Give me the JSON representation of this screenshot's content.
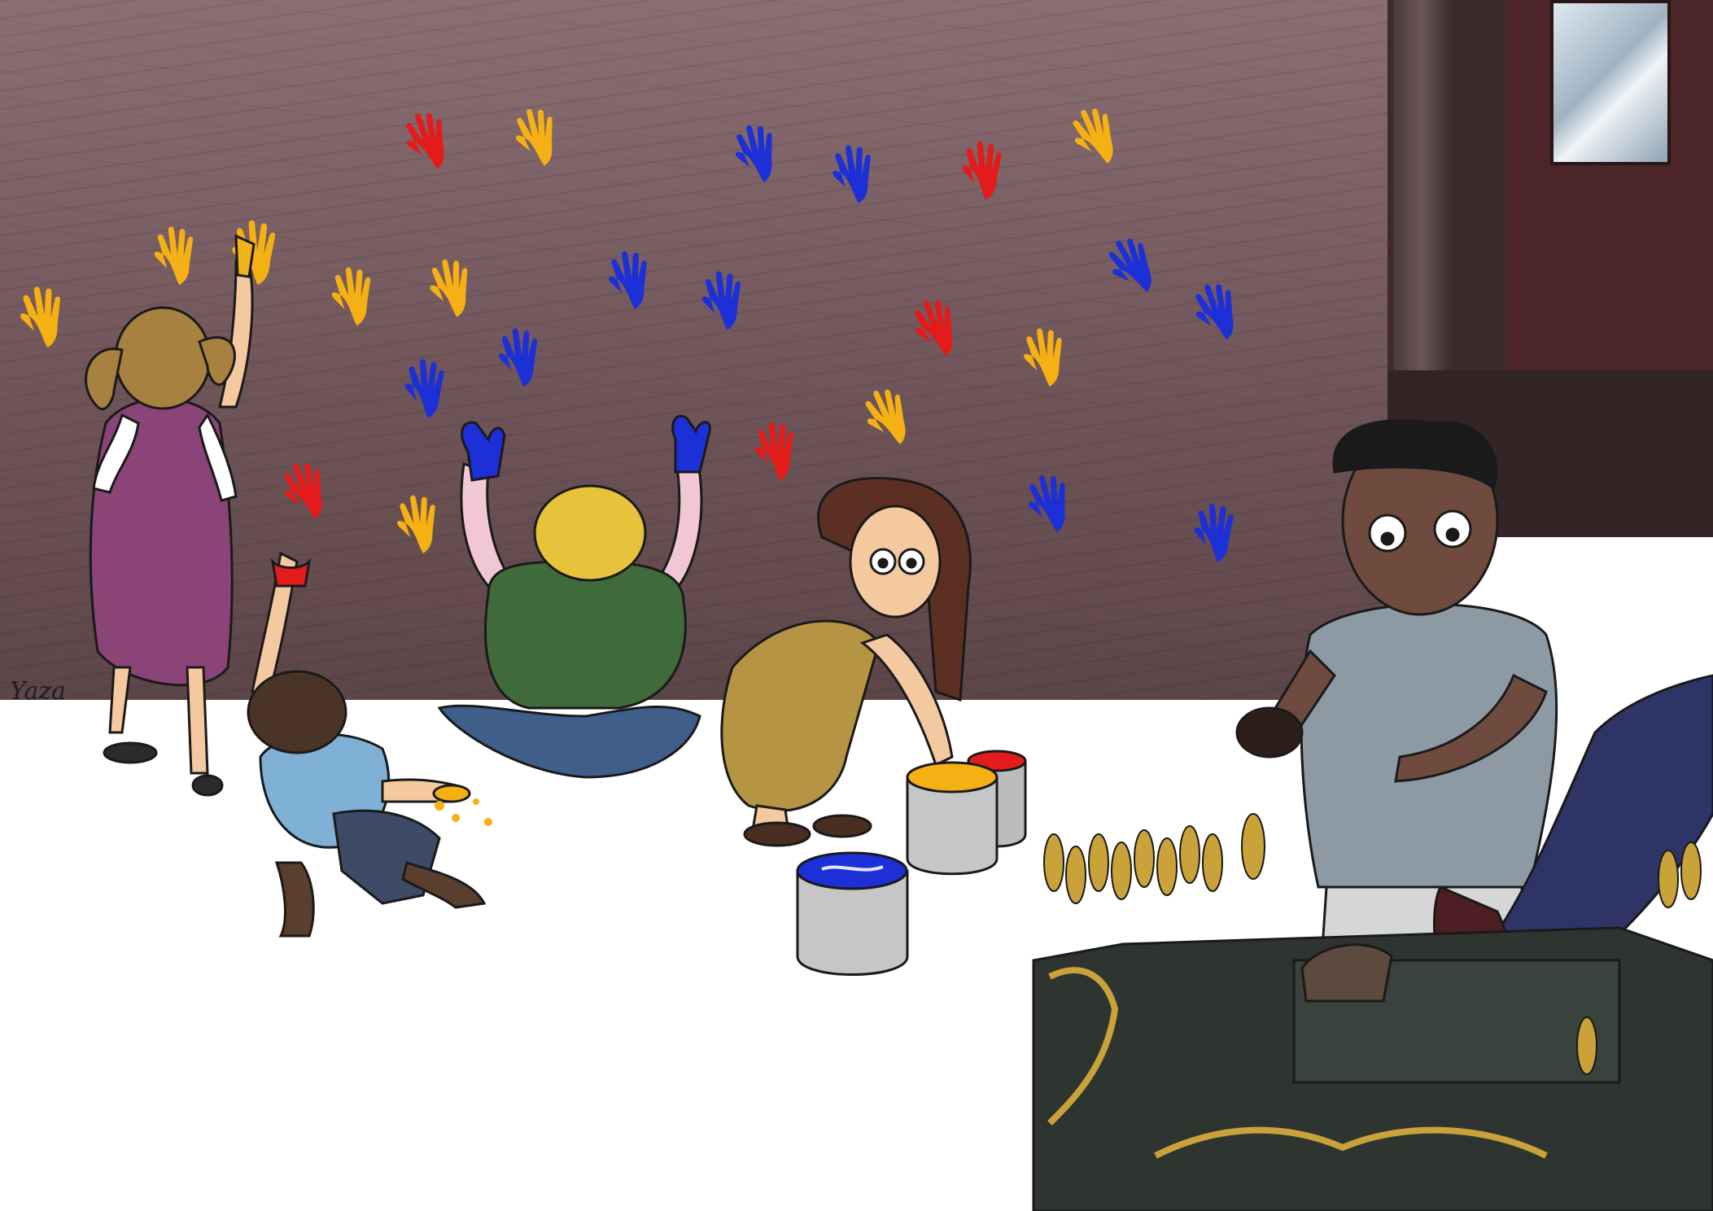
{
  "signature": "Yaza",
  "colors": {
    "wall": "#76595d",
    "floor": "#ffffff",
    "paint_red": "#e31b1b",
    "paint_yellow": "#f5b014",
    "paint_blue": "#1d2fd6",
    "shoe_stand_gold": "#c9a23a",
    "shoe_stand_body": "#2e3430"
  },
  "handprint_icons": "hand-icon",
  "paint_cans": [
    "blue",
    "yellow",
    "red"
  ]
}
